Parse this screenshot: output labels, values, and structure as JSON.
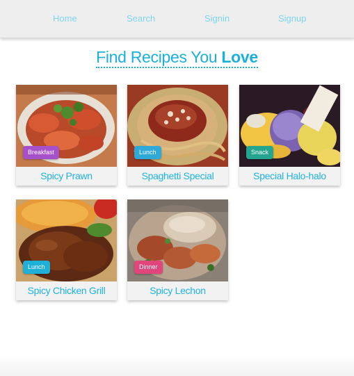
{
  "nav": {
    "items": [
      "Home",
      "Search",
      "Signin",
      "Signup"
    ]
  },
  "heading": {
    "prefix": "Find Recipes You",
    "emphasis": "Love"
  },
  "colors": {
    "accent": "#1ab0dc",
    "breakfast": "#a651c9",
    "lunch": "#1fb0d8",
    "snack": "#25a58f",
    "dinner": "#e0457b"
  },
  "recipes": [
    {
      "title": "Spicy Prawn",
      "category": "Breakfast"
    },
    {
      "title": "Spaghetti Special",
      "category": "Lunch"
    },
    {
      "title": "Special Halo-halo",
      "category": "Snack"
    },
    {
      "title": "Spicy Chicken Grill",
      "category": "Lunch"
    },
    {
      "title": "Spicy Lechon",
      "category": "Dinner"
    }
  ]
}
